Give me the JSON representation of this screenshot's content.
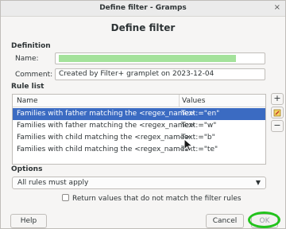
{
  "window": {
    "title": "Define filter - Gramps",
    "close_glyph": "×"
  },
  "heading": "Define filter",
  "definition": {
    "section_label": "Definition",
    "name_label": "Name:",
    "name_value": "",
    "comment_label": "Comment:",
    "comment_value": "Created by Filter+ gramplet on 2023-12-04"
  },
  "rule_list": {
    "section_label": "Rule list",
    "columns": [
      "Name",
      "Values"
    ],
    "rows": [
      {
        "name": "Families with father matching the <regex_name>",
        "values": "Text:=\"en\"",
        "selected": true
      },
      {
        "name": "Families with father matching the <regex_name>",
        "values": "Text:=\"w\"",
        "selected": false
      },
      {
        "name": "Families with child matching the <regex_name>",
        "values": "Text:=\"b\"",
        "selected": false
      },
      {
        "name": "Families with child matching the <regex_name>",
        "values": "Text:=\"te\"",
        "selected": false
      }
    ],
    "buttons": {
      "add": "+",
      "edit_icon": "pencil-icon",
      "remove": "−"
    }
  },
  "options": {
    "section_label": "Options",
    "logic_selected": "All rules must apply",
    "invert_label": "Return values that do not match the filter rules",
    "invert_checked": false
  },
  "footer": {
    "help": "Help",
    "cancel": "Cancel",
    "ok": "OK"
  },
  "colors": {
    "selection": "#3b6bc2",
    "name_fill": "#a4e29b",
    "ok_highlight": "#22c31c"
  }
}
